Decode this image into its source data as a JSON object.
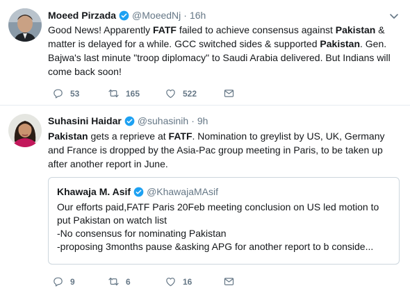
{
  "tweets": [
    {
      "name": "Moeed Pirzada",
      "handle": "@MoeedNj",
      "dot": "·",
      "time": "16h",
      "text_parts": [
        "Good News! Apparently ",
        "FATF",
        " failed to achieve consensus against ",
        "Pakistan",
        " & matter is delayed for a while. GCC switched sides & supported ",
        "Pakistan",
        ". Gen. Bajwa's last minute \"troop diplomacy\" to Saudi Arabia delivered. But Indians will come back soon!"
      ],
      "replies": "53",
      "retweets": "165",
      "likes": "522"
    },
    {
      "name": "Suhasini Haidar",
      "handle": "@suhasinih",
      "dot": "·",
      "time": "9h",
      "text_parts": [
        "Pakistan",
        " gets a reprieve at ",
        "FATF",
        ". Nomination to greylist by US, UK, Germany and France is dropped by the Asia-Pac group meeting in Paris, to be taken up after another report in June."
      ],
      "quote": {
        "name": "Khawaja M. Asif",
        "handle": "@KhawajaMAsif",
        "lines": [
          "Our efforts paid,FATF Paris 20Feb meeting conclusion on US led motion to put Pakistan on watch list",
          "-No consensus for nominating Pakistan",
          "-proposing 3months pause &asking APG for another report to b conside..."
        ]
      },
      "replies": "9",
      "retweets": "6",
      "likes": "16"
    }
  ],
  "icons": {
    "verified": "verified-badge-icon",
    "caret": "chevron-down-icon",
    "reply": "reply-icon",
    "retweet": "retweet-icon",
    "like": "heart-icon",
    "dm": "envelope-icon"
  },
  "colors": {
    "verified": "#1da1f2",
    "secondary_text": "#657786",
    "border": "#e6ecf0"
  }
}
